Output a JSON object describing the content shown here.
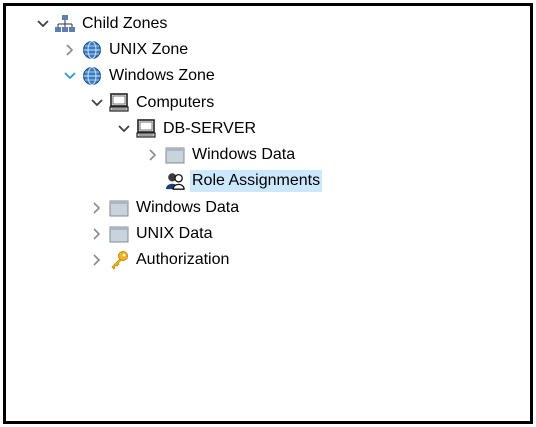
{
  "tree": {
    "items": [
      {
        "label": "Child Zones"
      },
      {
        "label": "UNIX Zone"
      },
      {
        "label": "Windows Zone"
      },
      {
        "label": "Computers"
      },
      {
        "label": "DB-SERVER"
      },
      {
        "label": "Windows Data"
      },
      {
        "label": "Role Assignments"
      },
      {
        "label": "Windows Data"
      },
      {
        "label": "UNIX Data"
      },
      {
        "label": "Authorization"
      }
    ]
  },
  "colors": {
    "selection": "#cce8ff",
    "chevron_default": "#7a7a7a",
    "chevron_active": "#2f9ad6",
    "folder": "#c9d3dc",
    "globe": "#2e6fb5"
  },
  "icons": {
    "child_zones": "network-icon",
    "zone": "globe-icon",
    "computers": "computer-icon",
    "data": "folder-icon",
    "roles": "users-icon",
    "authorization": "key-icon"
  }
}
